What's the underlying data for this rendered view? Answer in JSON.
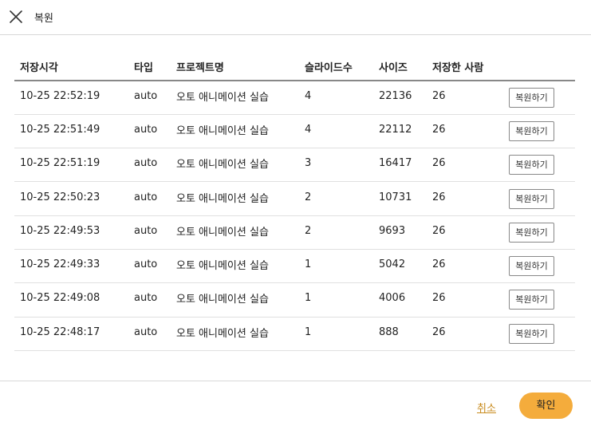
{
  "dialog": {
    "title": "복원",
    "close_icon": "close-icon"
  },
  "table": {
    "headers": [
      "저장시각",
      "타입",
      "프로젝트명",
      "슬라이드수",
      "사이즈",
      "저장한 사람",
      ""
    ],
    "restore_label": "복원하기",
    "rows": [
      {
        "time": "10-25 22:52:19",
        "type": "auto",
        "project": "오토 애니메이션 실습",
        "slides": "4",
        "size": "22136",
        "user": "26"
      },
      {
        "time": "10-25 22:51:49",
        "type": "auto",
        "project": "오토 애니메이션 실습",
        "slides": "4",
        "size": "22112",
        "user": "26"
      },
      {
        "time": "10-25 22:51:19",
        "type": "auto",
        "project": "오토 애니메이션 실습",
        "slides": "3",
        "size": "16417",
        "user": "26"
      },
      {
        "time": "10-25 22:50:23",
        "type": "auto",
        "project": "오토 애니메이션 실습",
        "slides": "2",
        "size": "10731",
        "user": "26"
      },
      {
        "time": "10-25 22:49:53",
        "type": "auto",
        "project": "오토 애니메이션 실습",
        "slides": "2",
        "size": "9693",
        "user": "26"
      },
      {
        "time": "10-25 22:49:33",
        "type": "auto",
        "project": "오토 애니메이션 실습",
        "slides": "1",
        "size": "5042",
        "user": "26"
      },
      {
        "time": "10-25 22:49:08",
        "type": "auto",
        "project": "오토 애니메이션 실습",
        "slides": "1",
        "size": "4006",
        "user": "26"
      },
      {
        "time": "10-25 22:48:17",
        "type": "auto",
        "project": "오토 애니메이션 실습",
        "slides": "1",
        "size": "888",
        "user": "26"
      }
    ]
  },
  "footer": {
    "cancel_label": "취소",
    "confirm_label": "확인"
  },
  "colors": {
    "accent": "#f4ac3c",
    "link": "#c88a1c"
  }
}
